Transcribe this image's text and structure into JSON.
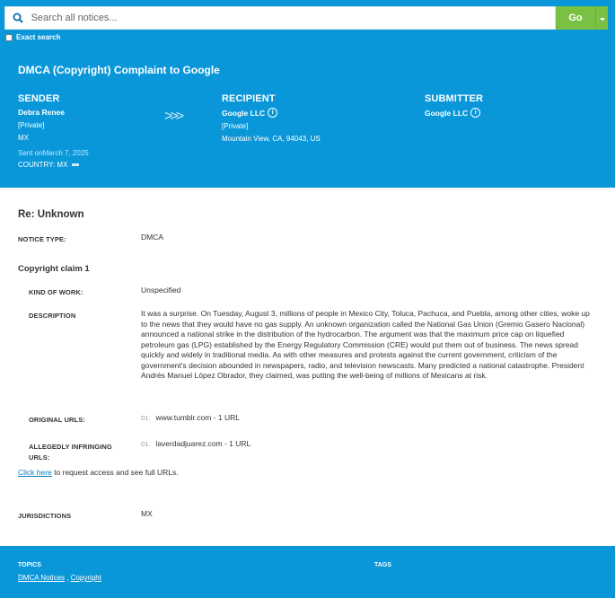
{
  "search": {
    "placeholder": "Search all notices...",
    "go_label": "Go",
    "exact_label": "Exact search"
  },
  "notice": {
    "title": "DMCA (Copyright) Complaint to Google",
    "sender": {
      "heading": "SENDER",
      "name": "Debra Renee",
      "line1": "[Private]",
      "line2": "MX",
      "sent": "Sent onMarch 7, 2025",
      "country": "COUNTRY: MX"
    },
    "recipient": {
      "heading": "RECIPIENT",
      "name": "Google LLC",
      "line1": "[Private]",
      "line2": "Mountain View, CA, 94043, US"
    },
    "submitter": {
      "heading": "SUBMITTER",
      "name": "Google LLC"
    }
  },
  "body": {
    "re": "Re: Unknown",
    "notice_type_label": "NOTICE TYPE:",
    "notice_type": "DMCA",
    "claim_title": "Copyright claim 1",
    "kind_label": "KIND OF WORK:",
    "kind": "Unspecified",
    "description_label": "DESCRIPTION",
    "description": "It was a surprise. On Tuesday, August 3, millions of people in Mexico City, Toluca, Pachuca, and Puebla, among other cities, woke up to the news that they would have no gas supply. An unknown organization called the National Gas Union (Gremio Gasero Nacional) announced a national strike in the distribution of the hydrocarbon. The argument was that the maximum price cap on liquefied petroleum gas (LPG) established by the Energy Regulatory Commission (CRE) would put them out of business. The news spread quickly and widely in traditional media. As with other measures and protests against the current government, criticism of the government's decision abounded in newspapers, radio, and television newscasts. Many predicted a national catastrophe. President Andrés Manuel López Obrador, they claimed, was putting the well-being of millions of Mexicans at risk.",
    "original_label": "ORIGINAL URLS:",
    "original_num": "01.",
    "original_url": "www.tumblr.com - 1 URL",
    "infringing_label_1": "ALLEGEDLY INFRINGING",
    "infringing_label_2": "URLS:",
    "infringing_num": "01.",
    "infringing_url": "laverdadjuarez.com - 1 URL",
    "click_link": "Click here",
    "click_rest": " to request access and see full URLs.",
    "jurisdictions_label": "JURISDICTIONS",
    "jurisdictions": "MX"
  },
  "footer": {
    "topics_label": "TOPICS",
    "tags_label": "TAGS",
    "topic1": "DMCA Notices",
    "separator": " , ",
    "topic2": "Copyright"
  }
}
